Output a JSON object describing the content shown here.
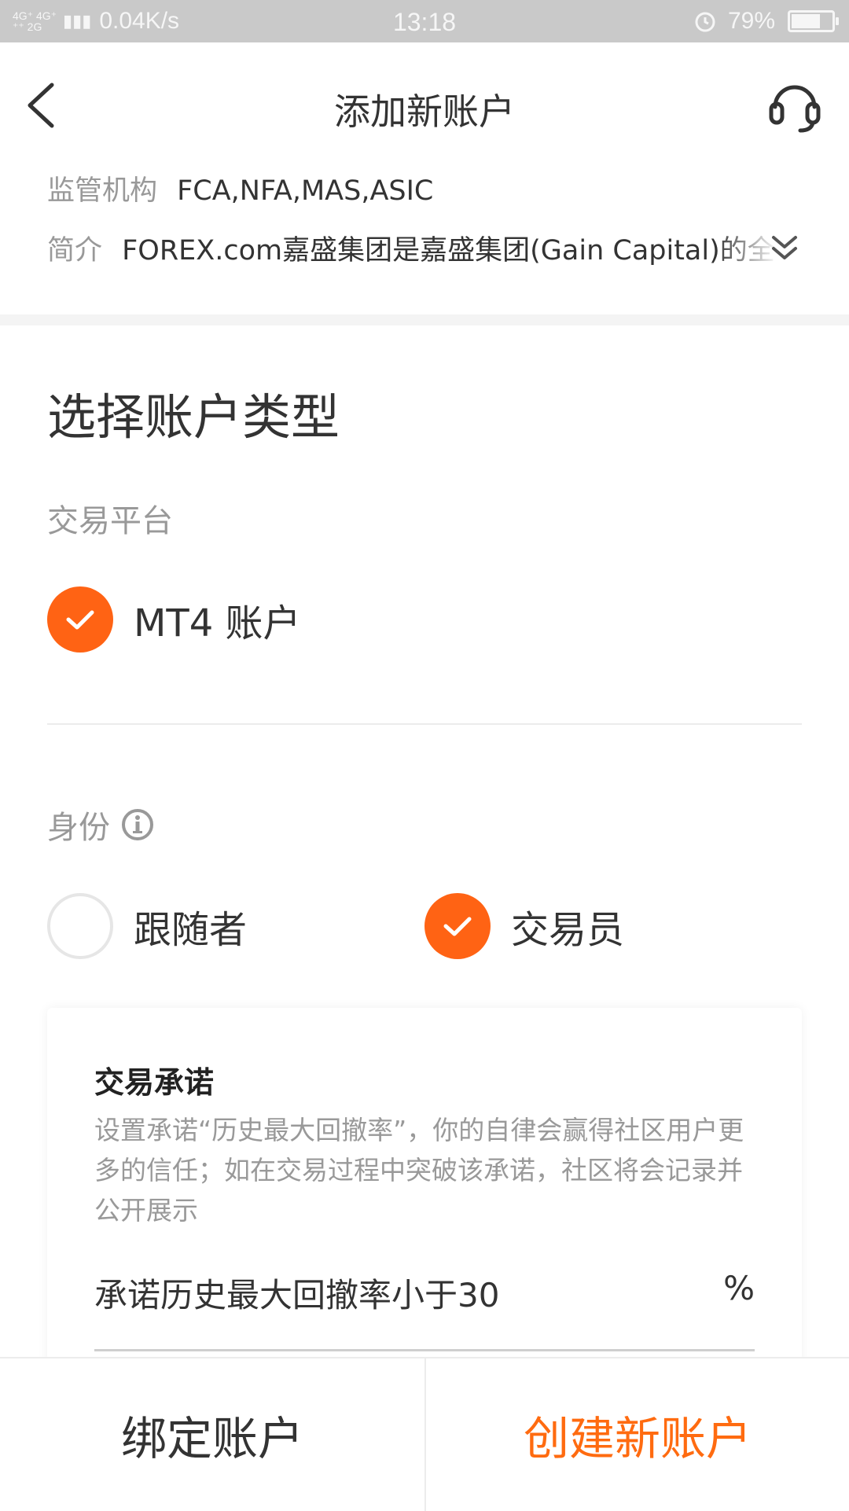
{
  "status_bar": {
    "network_top": "4G⁺ 4G⁺",
    "network_bottom": "⁺⁺ 2G",
    "speed": "0.04K/s",
    "time": "13:18",
    "battery": "79%",
    "battery_level": 0.79
  },
  "nav": {
    "title": "添加新账户",
    "back_icon": "chevron-left-icon",
    "support_icon": "headset-icon"
  },
  "broker": {
    "regulator_label": "监管机构",
    "regulator_value": "FCA,NFA,MAS,ASIC",
    "intro_label": "简介",
    "intro_value": "FOREX.com嘉盛集团是嘉盛集团(Gain Capital)的全",
    "expand_icon": "double-chevron-down-icon"
  },
  "account_type": {
    "section_title": "选择账户类型",
    "platform_label": "交易平台",
    "platform_option": "MT4 账户",
    "identity_label": "身份",
    "identity_options": [
      {
        "label": "跟随者",
        "selected": false
      },
      {
        "label": "交易员",
        "selected": true
      }
    ]
  },
  "commitment": {
    "title": "交易承诺",
    "description": "设置承诺“历史最大回撤率”，你的自律会赢得社区用户更多的信任；如在交易过程中突破该承诺，社区将会记录并公开展示",
    "input_text": "承诺历史最大回撤率小于30",
    "unit": "%"
  },
  "bottom": {
    "bind_label": "绑定账户",
    "create_label": "创建新账户"
  },
  "colors": {
    "accent": "#ff6314",
    "create_text": "#ff6b10",
    "status_bar": "#c9c9c9"
  }
}
